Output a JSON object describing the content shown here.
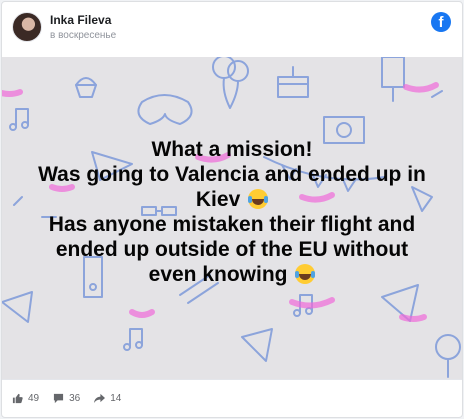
{
  "post": {
    "author": "Inka Fileva",
    "timestamp": "в воскресенье",
    "platform_icon": "facebook-icon",
    "lines": [
      {
        "text": "What a mission!",
        "emoji": false
      },
      {
        "text": "Was going to Valencia and ended up in",
        "emoji": false
      },
      {
        "text": "Kiev",
        "emoji": true
      },
      {
        "text": "Has anyone mistaken their flight and",
        "emoji": false
      },
      {
        "text": "ended up outside of the EU without",
        "emoji": false
      },
      {
        "text": "even knowing",
        "emoji": true
      }
    ],
    "emoji_name": "face-with-tears-of-joy-icon"
  },
  "stats": {
    "likes": "49",
    "comments": "36",
    "shares": "14"
  },
  "colors": {
    "brand": "#1877f2",
    "background": "#e4e3e6",
    "doodle_blue": "#6f8fd8",
    "doodle_pink": "#f06ad8"
  }
}
